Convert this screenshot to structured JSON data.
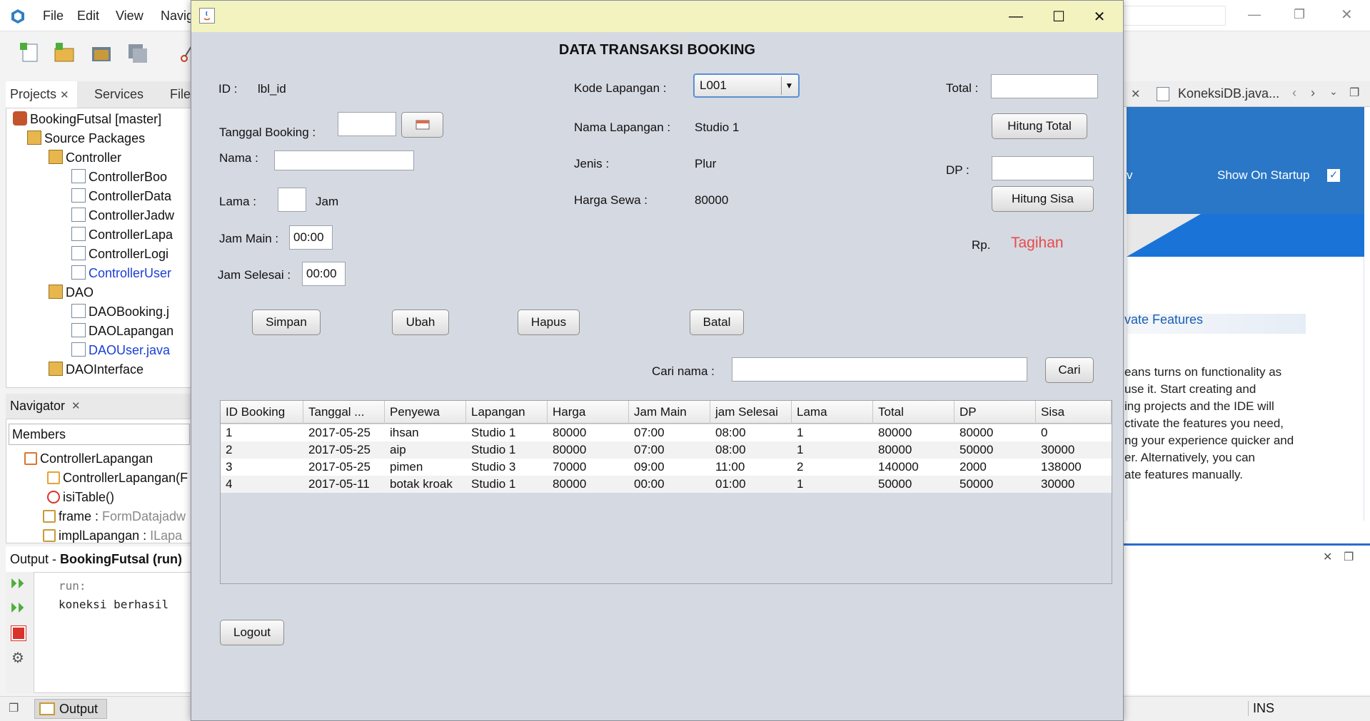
{
  "ide": {
    "menus": [
      "File",
      "Edit",
      "View",
      "Navig"
    ],
    "project_tabs": [
      "Projects",
      "Services",
      "Files"
    ],
    "tree": [
      {
        "label": "BookingFutsal [master]",
        "blue": false
      },
      {
        "label": "Source Packages",
        "blue": false
      },
      {
        "label": "Controller",
        "blue": false
      },
      {
        "label": "ControllerBoo",
        "blue": false
      },
      {
        "label": "ControllerData",
        "blue": false
      },
      {
        "label": "ControllerJadw",
        "blue": false
      },
      {
        "label": "ControllerLapa",
        "blue": false
      },
      {
        "label": "ControllerLogi",
        "blue": false
      },
      {
        "label": "ControllerUser",
        "blue": true
      },
      {
        "label": "DAO",
        "blue": false
      },
      {
        "label": "DAOBooking.j",
        "blue": false
      },
      {
        "label": "DAOLapangan",
        "blue": false
      },
      {
        "label": "DAOUser.java",
        "blue": true
      },
      {
        "label": "DAOInterface",
        "blue": false
      }
    ],
    "navigator_title": "Navigator",
    "members_label": "Members",
    "nav_items": [
      {
        "label": "ControllerLapangan",
        "suffix": ""
      },
      {
        "label": "ControllerLapangan(F",
        "suffix": ""
      },
      {
        "label": "isiTable()",
        "suffix": ""
      },
      {
        "label": "frame : ",
        "suffix": "FormDatajadw"
      },
      {
        "label": "implLapangan : ",
        "suffix": "ILapa"
      }
    ],
    "output_title_prefix": "Output - ",
    "output_title_bold": "BookingFutsal (run)",
    "output_lines": [
      "run:",
      "koneksi berhasil"
    ],
    "output_tab": "Output",
    "status_ins": "INS",
    "right_tab": "KoneksiDB.java...",
    "show_on_startup": "Show On Startup",
    "right_partial_v": "v",
    "features_heading": "vate Features",
    "start_text": [
      "eans turns on functionality as",
      "use it. Start creating and",
      "ing projects and the IDE will",
      "ctivate the features you need,",
      "ng your experience quicker and",
      "er. Alternatively, you can",
      "ate features manually."
    ]
  },
  "dialog": {
    "title": "DATA TRANSAKSI BOOKING",
    "labels": {
      "id": "ID :",
      "id_value": "lbl_id",
      "tanggal": "Tanggal Booking :",
      "nama": "Nama :",
      "lama": "Lama :",
      "jam_unit": "Jam",
      "jam_main": "Jam Main :",
      "jam_selesai": "Jam Selesai :",
      "kode": "Kode Lapangan :",
      "nama_lapangan": "Nama Lapangan :",
      "jenis": "Jenis :",
      "harga_sewa": "Harga Sewa :",
      "total": "Total :",
      "dp": "DP :",
      "rp": "Rp.",
      "cari_nama": "Cari nama :"
    },
    "values": {
      "jam_main": "00:00",
      "jam_selesai": "00:00",
      "kode": "L001",
      "nama_lapangan": "Studio 1",
      "jenis": "Plur",
      "harga_sewa": "80000",
      "tagihan": "Tagihan"
    },
    "buttons": {
      "hitung_total": "Hitung Total",
      "hitung_sisa": "Hitung Sisa",
      "simpan": "Simpan",
      "ubah": "Ubah",
      "hapus": "Hapus",
      "batal": "Batal",
      "cari": "Cari",
      "logout": "Logout"
    },
    "table": {
      "columns": [
        "ID Booking",
        "Tanggal ...",
        "Penyewa",
        "Lapangan",
        "Harga",
        "Jam Main",
        "jam Selesai",
        "Lama",
        "Total",
        "DP",
        "Sisa"
      ],
      "rows": [
        [
          "1",
          "2017-05-25",
          "ihsan",
          "Studio 1",
          "80000",
          "07:00",
          "08:00",
          "1",
          "80000",
          "80000",
          "0"
        ],
        [
          "2",
          "2017-05-25",
          "aip",
          "Studio 1",
          "80000",
          "07:00",
          "08:00",
          "1",
          "80000",
          "50000",
          "30000"
        ],
        [
          "3",
          "2017-05-25",
          "pimen",
          "Studio 3",
          "70000",
          "09:00",
          "11:00",
          "2",
          "140000",
          "2000",
          "138000"
        ],
        [
          "4",
          "2017-05-11",
          "botak kroak",
          "Studio 1",
          "80000",
          "00:00",
          "01:00",
          "1",
          "50000",
          "50000",
          "30000"
        ]
      ]
    }
  }
}
